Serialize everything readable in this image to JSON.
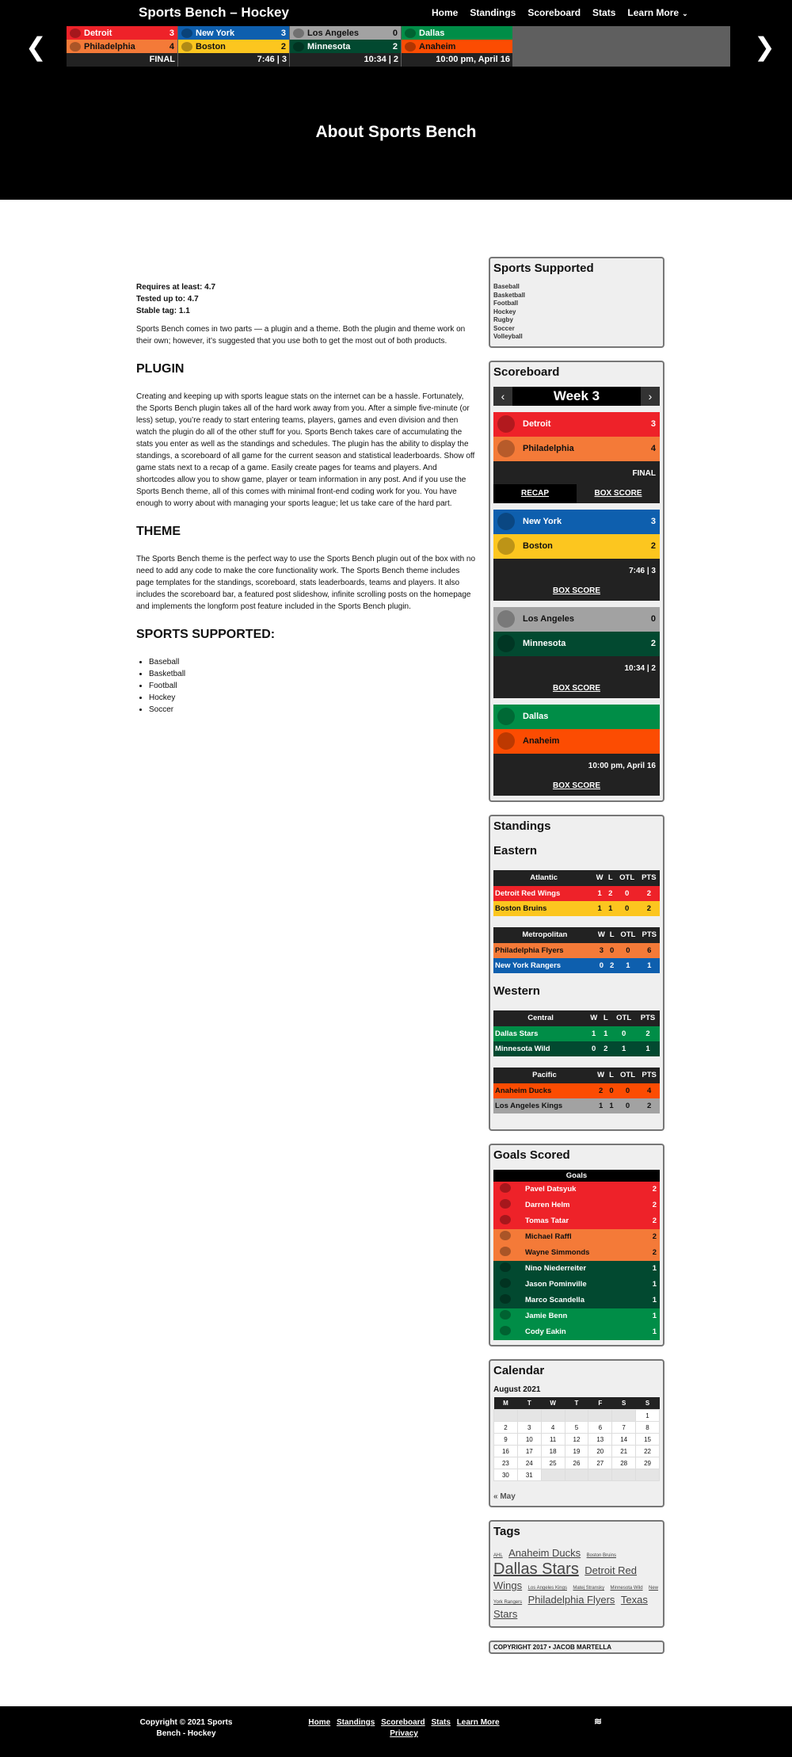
{
  "site": {
    "title": "Sports Bench – Hockey"
  },
  "nav": {
    "items": [
      "Home",
      "Standings",
      "Scoreboard",
      "Stats",
      "Learn More"
    ]
  },
  "scorebar": {
    "games": [
      {
        "away": {
          "name": "Detroit",
          "score": "3",
          "color": "#ee2229",
          "text": "#fff"
        },
        "home": {
          "name": "Philadelphia",
          "score": "4",
          "color": "#f47a38",
          "text": "#111"
        },
        "status": "FINAL"
      },
      {
        "away": {
          "name": "New York",
          "score": "3",
          "color": "#0e5fae",
          "text": "#fff"
        },
        "home": {
          "name": "Boston",
          "score": "2",
          "color": "#fcc61f",
          "text": "#111"
        },
        "status": "7:46 | 3"
      },
      {
        "away": {
          "name": "Los Angeles",
          "score": "0",
          "color": "#a2a2a2",
          "text": "#111"
        },
        "home": {
          "name": "Minnesota",
          "score": "2",
          "color": "#024930",
          "text": "#fff"
        },
        "status": "10:34 | 2"
      },
      {
        "away": {
          "name": "Dallas",
          "score": "",
          "color": "#008d47",
          "text": "#fff"
        },
        "home": {
          "name": "Anaheim",
          "score": "",
          "color": "#fc4c02",
          "text": "#111"
        },
        "status": "10:00 pm, April 16"
      }
    ]
  },
  "page": {
    "title": "About Sports Bench"
  },
  "content": {
    "meta": [
      "Requires at least: 4.7",
      "Tested up to: 4.7",
      "Stable tag: 1.1"
    ],
    "intro": "Sports Bench comes in two parts — a plugin and a theme. Both the plugin and theme work on their own; however, it’s suggested that you use both to get the most out of both products.",
    "plugin_heading": "PLUGIN",
    "plugin_text": "Creating and keeping up with sports league stats on the internet can be a hassle. Fortunately, the Sports Bench plugin takes all of the hard work away from you. After a simple five-minute (or less) setup, you’re ready to start entering teams, players, games and even division and then watch the plugin do all of the other stuff for you. Sports Bench takes care of accumulating the stats you enter as well as the standings and schedules. The plugin has the ability to display the standings, a scoreboard of all game for the current season and statistical leaderboards. Show off game stats next to a recap of a game. Easily create pages for teams and players. And shortcodes allow you to show game, player or team information in any post. And if you use the Sports Bench theme, all of this comes with minimal front-end coding work for you. You have enough to worry about with managing your sports league; let us take care of the hard part.",
    "theme_heading": "THEME",
    "theme_text": "The Sports Bench theme is the perfect way to use the Sports Bench plugin out of the box with no need to add any code to make the core functionality work. The Sports Bench theme includes page templates for the standings, scoreboard, stats leaderboards, teams and players. It also includes the scoreboard bar, a featured post slideshow, infinite scrolling posts on the homepage and implements the longform post feature included in the Sports Bench plugin.",
    "sports_heading": "SPORTS SUPPORTED:",
    "sports": [
      "Baseball",
      "Basketball",
      "Football",
      "Hockey",
      "Soccer"
    ]
  },
  "sidebar": {
    "sports_widget": {
      "title": "Sports Supported",
      "items": [
        "Baseball",
        "Basketball",
        "Football",
        "Hockey",
        "Rugby",
        "Soccer",
        "Volleyball"
      ]
    },
    "scoreboard": {
      "title": "Scoreboard",
      "week": "Week 3",
      "recap": "RECAP",
      "box_score": "BOX SCORE"
    },
    "standings": {
      "title": "Standings",
      "conferences": [
        {
          "name": "Eastern",
          "divisions": [
            {
              "name": "Atlantic",
              "rows": [
                {
                  "team": "Detroit Red Wings",
                  "w": "1",
                  "l": "2",
                  "otl": "0",
                  "pts": "2",
                  "color": "#ee2229",
                  "text": "#fff"
                },
                {
                  "team": "Boston Bruins",
                  "w": "1",
                  "l": "1",
                  "otl": "0",
                  "pts": "2",
                  "color": "#fcc61f",
                  "text": "#111"
                }
              ]
            },
            {
              "name": "Metropolitan",
              "rows": [
                {
                  "team": "Philadelphia Flyers",
                  "w": "3",
                  "l": "0",
                  "otl": "0",
                  "pts": "6",
                  "color": "#f47a38",
                  "text": "#111"
                },
                {
                  "team": "New York Rangers",
                  "w": "0",
                  "l": "2",
                  "otl": "1",
                  "pts": "1",
                  "color": "#0e5fae",
                  "text": "#fff"
                }
              ]
            }
          ]
        },
        {
          "name": "Western",
          "divisions": [
            {
              "name": "Central",
              "rows": [
                {
                  "team": "Dallas Stars",
                  "w": "1",
                  "l": "1",
                  "otl": "0",
                  "pts": "2",
                  "color": "#008d47",
                  "text": "#fff"
                },
                {
                  "team": "Minnesota Wild",
                  "w": "0",
                  "l": "2",
                  "otl": "1",
                  "pts": "1",
                  "color": "#024930",
                  "text": "#fff"
                }
              ]
            },
            {
              "name": "Pacific",
              "rows": [
                {
                  "team": "Anaheim Ducks",
                  "w": "2",
                  "l": "0",
                  "otl": "0",
                  "pts": "4",
                  "color": "#fc4c02",
                  "text": "#111"
                },
                {
                  "team": "Los Angeles Kings",
                  "w": "1",
                  "l": "1",
                  "otl": "0",
                  "pts": "2",
                  "color": "#a2a2a2",
                  "text": "#111"
                }
              ]
            }
          ]
        }
      ],
      "cols": [
        "W",
        "L",
        "OTL",
        "PTS"
      ]
    },
    "goals": {
      "title": "Goals Scored",
      "header": "Goals",
      "rows": [
        {
          "player": "Pavel Datsyuk",
          "goals": "2",
          "color": "#ee2229",
          "text": "#fff"
        },
        {
          "player": "Darren Helm",
          "goals": "2",
          "color": "#ee2229",
          "text": "#fff"
        },
        {
          "player": "Tomas Tatar",
          "goals": "2",
          "color": "#ee2229",
          "text": "#fff"
        },
        {
          "player": "Michael Raffl",
          "goals": "2",
          "color": "#f47a38",
          "text": "#111"
        },
        {
          "player": "Wayne Simmonds",
          "goals": "2",
          "color": "#f47a38",
          "text": "#111"
        },
        {
          "player": "Nino Niederreiter",
          "goals": "1",
          "color": "#024930",
          "text": "#fff"
        },
        {
          "player": "Jason Pominville",
          "goals": "1",
          "color": "#024930",
          "text": "#fff"
        },
        {
          "player": "Marco Scandella",
          "goals": "1",
          "color": "#024930",
          "text": "#fff"
        },
        {
          "player": "Jamie Benn",
          "goals": "1",
          "color": "#008d47",
          "text": "#fff"
        },
        {
          "player": "Cody Eakin",
          "goals": "1",
          "color": "#008d47",
          "text": "#fff"
        }
      ]
    },
    "calendar": {
      "title": "Calendar",
      "month": "August 2021",
      "days": [
        "M",
        "T",
        "W",
        "T",
        "F",
        "S",
        "S"
      ],
      "weeks": [
        [
          "",
          "",
          "",
          "",
          "",
          "",
          "1"
        ],
        [
          "2",
          "3",
          "4",
          "5",
          "6",
          "7",
          "8"
        ],
        [
          "9",
          "10",
          "11",
          "12",
          "13",
          "14",
          "15"
        ],
        [
          "16",
          "17",
          "18",
          "19",
          "20",
          "21",
          "22"
        ],
        [
          "23",
          "24",
          "25",
          "26",
          "27",
          "28",
          "29"
        ],
        [
          "30",
          "31",
          "",
          "",
          "",
          "",
          ""
        ]
      ],
      "prev": "« May"
    },
    "tags": {
      "title": "Tags",
      "items": [
        {
          "t": "AHL",
          "s": "s"
        },
        {
          "t": "Anaheim Ducks",
          "s": "l"
        },
        {
          "t": "Boston Bruins",
          "s": "s"
        },
        {
          "t": "Dallas Stars",
          "s": "xl"
        },
        {
          "t": "Detroit Red Wings",
          "s": "l"
        },
        {
          "t": "Los Angeles Kings",
          "s": "s"
        },
        {
          "t": "Matej Stransky",
          "s": "s"
        },
        {
          "t": "Minnesota Wild",
          "s": "s"
        },
        {
          "t": "New York Rangers",
          "s": "s"
        },
        {
          "t": "Philadelphia Flyers",
          "s": "l"
        },
        {
          "t": "Texas Stars",
          "s": "l"
        }
      ]
    },
    "copyright_widget": "COPYRIGHT 2017 • JACOB MARTELLA"
  },
  "footer": {
    "copyright": "Copyright © 2021 Sports Bench - Hockey",
    "links": [
      "Home",
      "Standings",
      "Scoreboard",
      "Stats",
      "Learn More",
      "Privacy"
    ]
  }
}
